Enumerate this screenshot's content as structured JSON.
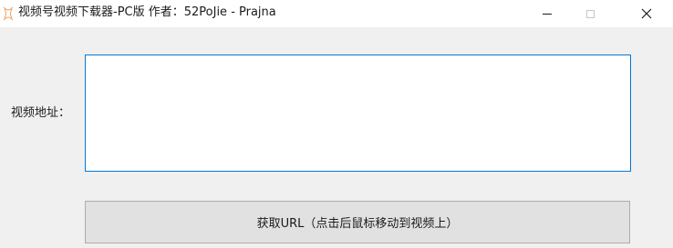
{
  "window": {
    "title": "视频号视频下载器-PC版   作者：52PoJie - Prajna",
    "app_icon": "app-logo-icon",
    "minimize_icon": "minimize-icon",
    "maximize_icon": "maximize-icon",
    "close_icon": "close-icon",
    "close_glyph": "✕"
  },
  "form": {
    "video_url_label": "视频地址：",
    "video_url_value": "",
    "fetch_button_label": "获取URL（点击后鼠标移动到视频上）"
  },
  "colors": {
    "accent": "#0078d7",
    "app_icon": "#f0a060",
    "background": "#f0f0f0"
  }
}
